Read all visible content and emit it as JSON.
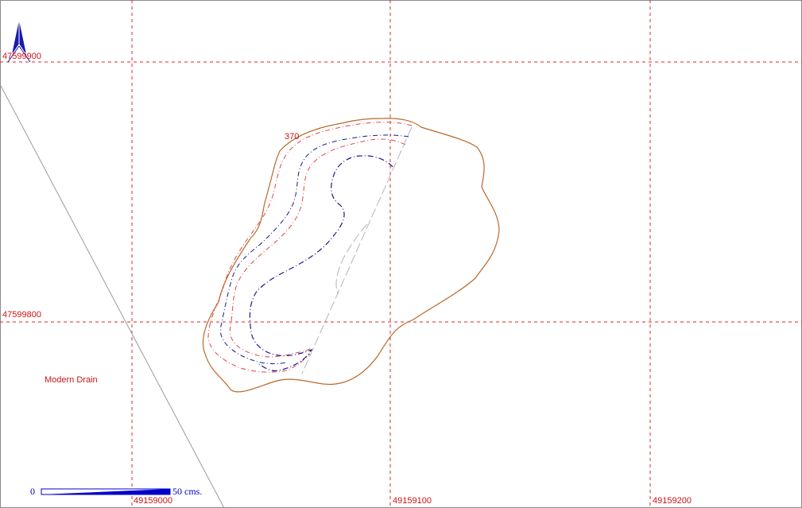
{
  "map": {
    "grid": {
      "easting_labels": [
        "49159000",
        "49159100",
        "49159200"
      ],
      "northing_labels": [
        "47599900",
        "47599800"
      ],
      "color": "#e32626"
    },
    "contour_label": "370",
    "feature_label": "Modern Drain",
    "scale_bar": {
      "start": "0",
      "end": "50",
      "unit": "cms."
    },
    "north_arrow_icon": "north-arrow-icon",
    "colors": {
      "outline": "#b8692a",
      "contour_red": "#e04848",
      "contour_blue": "#1a1a8c",
      "drain_line": "#9a9a9a",
      "labels": "#cc1414",
      "scale_bar": "#0000cc"
    }
  }
}
